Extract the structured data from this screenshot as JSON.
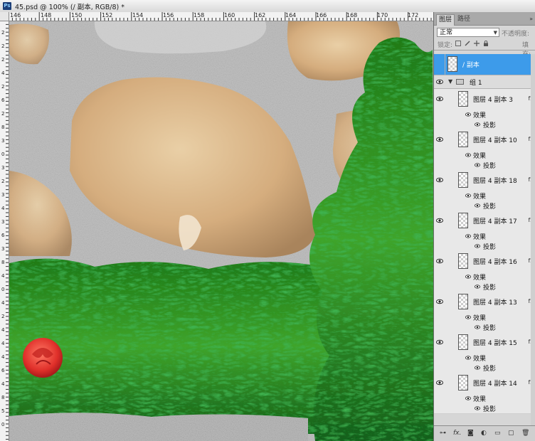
{
  "document": {
    "title": "45.psd @ 100% (/ 副本, RGB/8) *",
    "app_icon": "Ps"
  },
  "ruler": {
    "top_labels": [
      "146",
      "148",
      "150",
      "152",
      "154",
      "156",
      "158",
      "160",
      "162",
      "164",
      "166",
      "168",
      "170",
      "172"
    ],
    "left_labels": [
      "2",
      "2",
      "2",
      "4",
      "2",
      "6",
      "2",
      "8",
      "3",
      "0",
      "3",
      "2",
      "3",
      "4",
      "3",
      "6",
      "3",
      "8",
      "4",
      "0",
      "4",
      "2",
      "4",
      "4",
      "4",
      "6",
      "4",
      "8",
      "5",
      "0"
    ]
  },
  "layers_panel": {
    "tabs": [
      {
        "label": "图层"
      },
      {
        "label": "路径"
      }
    ],
    "collapse_icon": "double-arrow",
    "blend_mode": "正常",
    "opacity_label": "不透明度:",
    "lock_label": "锁定:",
    "fill_label": "填充:",
    "selected_layer": {
      "name": "/ 副本"
    },
    "group": {
      "name": "组 1"
    },
    "effects_label": "效果",
    "shadow_label": "投影",
    "layers": [
      {
        "name": "图层 4 副本 3"
      },
      {
        "name": "图层 4 副本 10"
      },
      {
        "name": "图层 4 副本 18"
      },
      {
        "name": "图层 4 副本 17"
      },
      {
        "name": "图层 4 副本 16"
      },
      {
        "name": "图层 4 副本 13"
      },
      {
        "name": "图层 4 副本 15"
      },
      {
        "name": "图层 4 副本 14"
      }
    ],
    "footer_icons": [
      "link-icon",
      "fx-icon",
      "mask-icon",
      "adjustment-icon",
      "folder-icon",
      "new-layer-icon",
      "trash-icon"
    ]
  },
  "colors": {
    "selection": "#3d9bea",
    "foliage": "#2f8a1f",
    "stone": "#d3ad7e",
    "gravel": "#b8b8b8",
    "rose": "#e0302a"
  }
}
